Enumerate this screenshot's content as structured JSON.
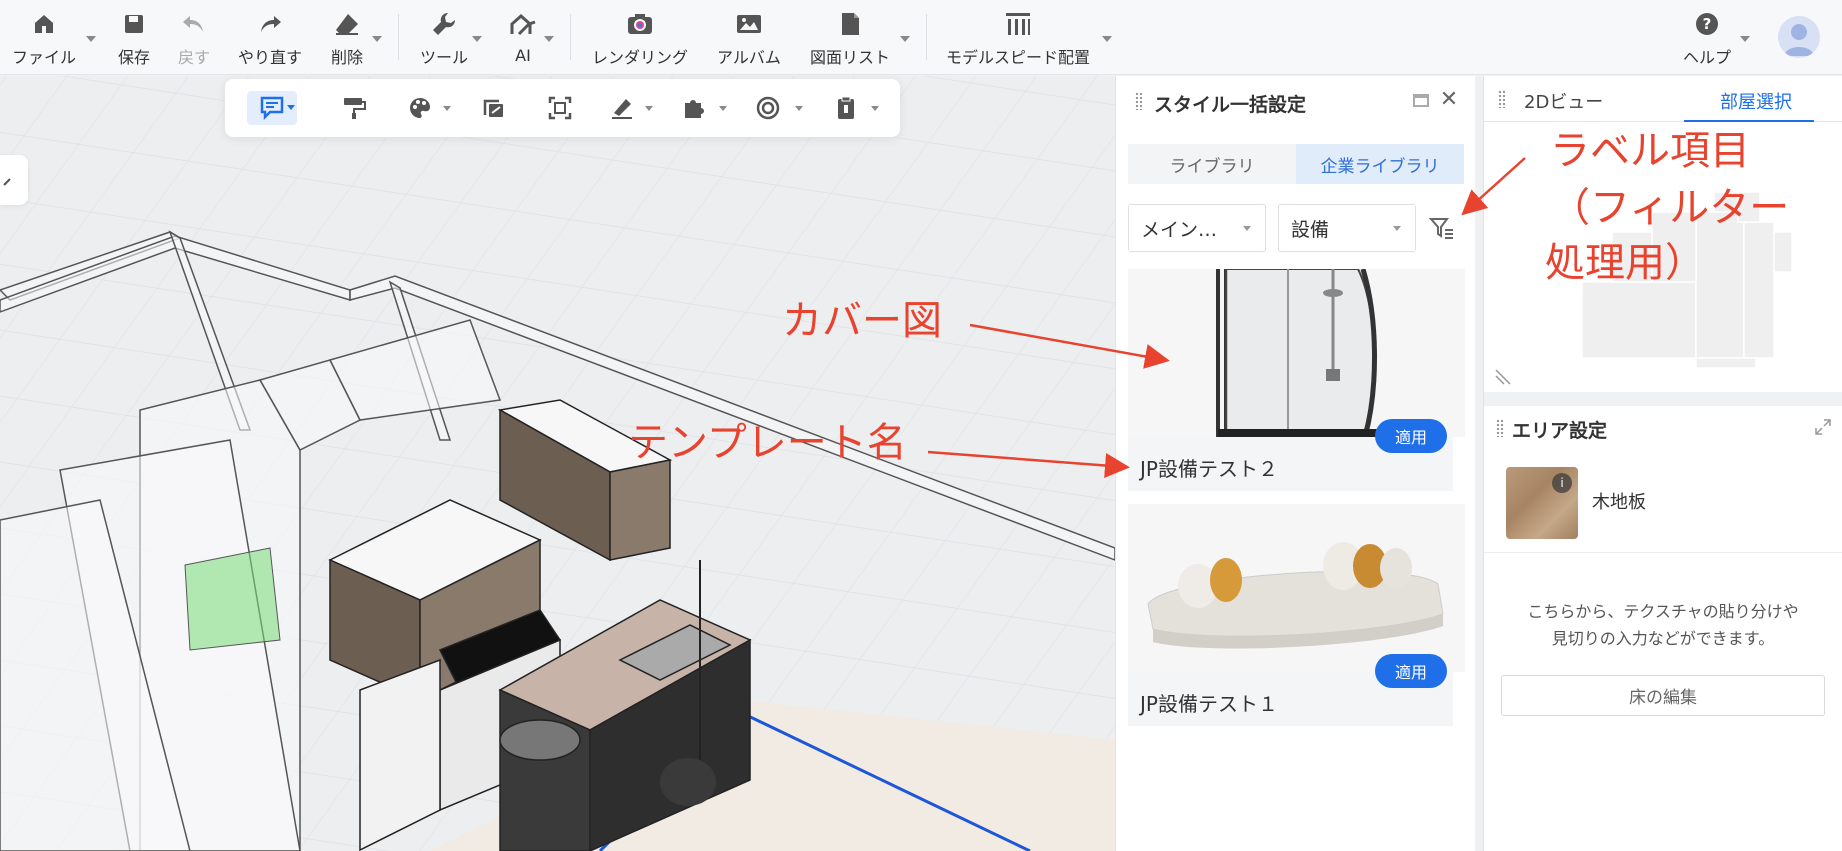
{
  "toolbar": {
    "items": [
      {
        "label": "ファイル",
        "icon": "home-icon"
      },
      {
        "label": "保存",
        "icon": "save-icon"
      },
      {
        "label": "戻す",
        "icon": "undo-icon"
      },
      {
        "label": "やり直す",
        "icon": "redo-icon"
      },
      {
        "label": "削除",
        "icon": "eraser-icon"
      },
      {
        "label": "ツール",
        "icon": "wrench-icon"
      },
      {
        "label": "AI",
        "icon": "ai-icon"
      },
      {
        "label": "レンダリング",
        "icon": "camera-icon"
      },
      {
        "label": "アルバム",
        "icon": "album-icon"
      },
      {
        "label": "図面リスト",
        "icon": "drawing-list-icon"
      },
      {
        "label": "モデルスピード配置",
        "icon": "model-speed-icon"
      },
      {
        "label": "ヘルプ",
        "icon": "help-icon"
      }
    ]
  },
  "style_panel": {
    "title": "スタイル一括設定",
    "tabs": [
      "ライブラリ",
      "企業ライブラリ"
    ],
    "active_tab": "企業ライブラリ",
    "dropdown_category": "メイン…",
    "dropdown_type": "設備",
    "cards": [
      {
        "name": "JP設備テスト２",
        "apply_label": "適用",
        "thumb": "shower-booth"
      },
      {
        "name": "JP設備テスト１",
        "apply_label": "適用",
        "thumb": "sofa"
      }
    ]
  },
  "right_panel": {
    "tabs": [
      "2Dビュー",
      "部屋選択"
    ],
    "active_tab": "部屋選択",
    "area_title": "エリア設定",
    "material_name": "木地板",
    "hint_line1": "こちらから、テクスチャの貼り分けや",
    "hint_line2": "見切りの入力などができます。",
    "edit_button": "床の編集"
  },
  "annotations": {
    "label_item_line1": "ラベル項目",
    "label_item_line2": "（フィルター",
    "label_item_line3": "処理用）",
    "cover_image": "カバー図",
    "template_name": "テンプレート名"
  },
  "colors": {
    "accent": "#1e6fe8",
    "annotation": "#e8432e"
  }
}
